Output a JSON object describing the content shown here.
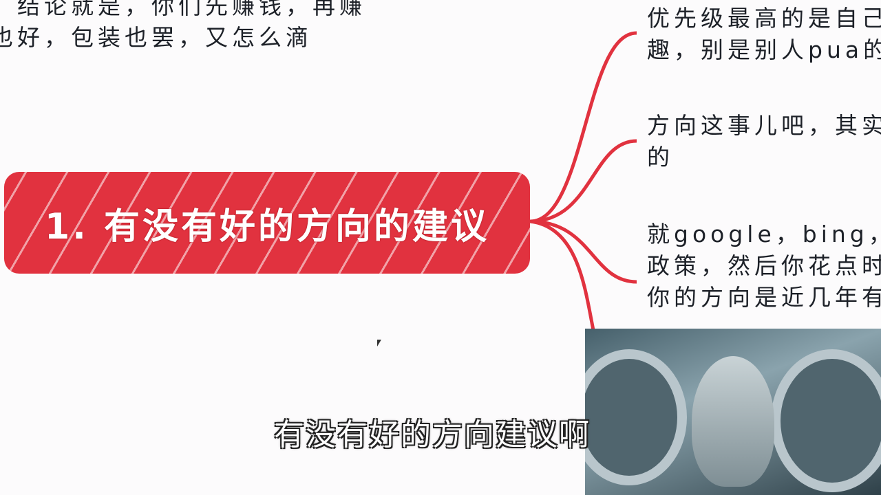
{
  "top_note": {
    "line1": "。结论就是，你们先赚钱，再赚",
    "line2": "也好，包装也罢，又怎么滴"
  },
  "central_node": {
    "label": "1. 有没有好的方向的建议",
    "color": "#e1323f"
  },
  "branches": [
    {
      "line1": "优先级最高的是自己",
      "line2": "趣，别是别人pua的"
    },
    {
      "line1": "方向这事儿吧，其实",
      "line2": "的"
    },
    {
      "line1": "就google，bing，你",
      "line2": "政策，然后你花点时",
      "line3": "你的方向是近几年有"
    }
  ],
  "subtitle": "有没有好的方向建议啊",
  "link_color": "#e1323f"
}
